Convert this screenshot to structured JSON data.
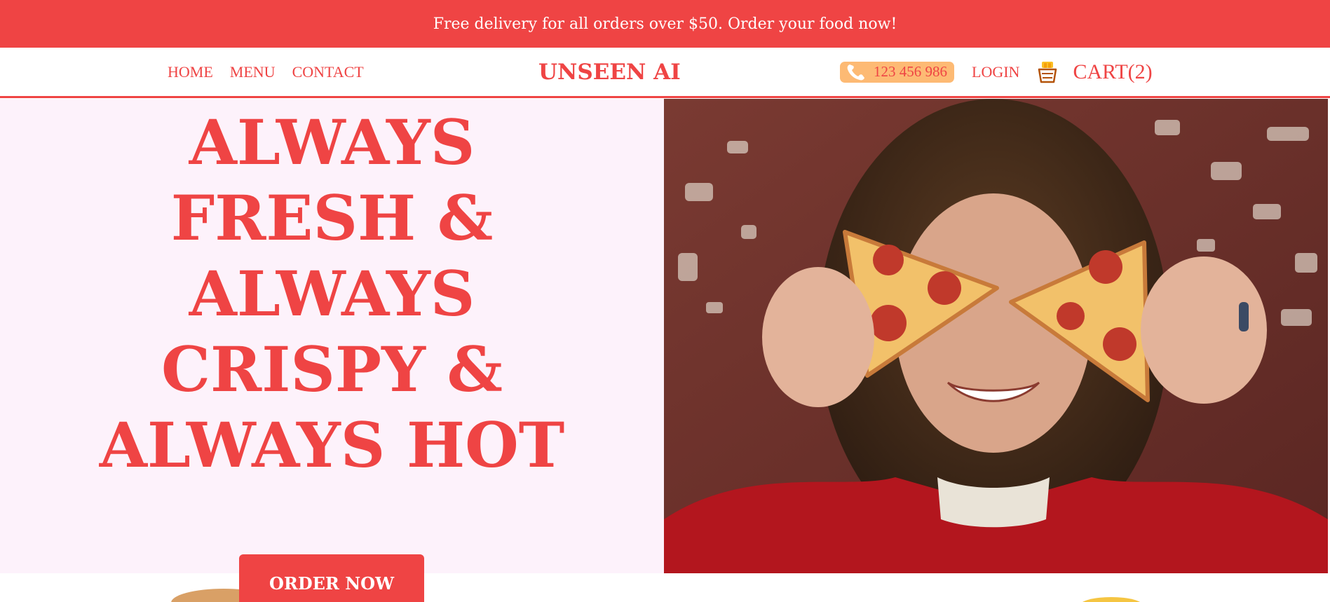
{
  "promo_banner": {
    "text": "Free delivery for all orders over $50. Order your food now!"
  },
  "nav": {
    "links": [
      {
        "label": "HOME"
      },
      {
        "label": "MENU"
      },
      {
        "label": "CONTACT"
      }
    ],
    "brand": "UNSEEN AI",
    "phone": {
      "icon": "phone-icon",
      "number": "123 456 986"
    },
    "login_label": "LOGIN",
    "basket_icon": "basket-icon",
    "cart_label": "CART(2)"
  },
  "hero": {
    "headline_lines": [
      "ALWAYS",
      "FRESH &",
      "ALWAYS",
      "CRISPY &",
      "ALWAYS HOT"
    ],
    "order_button_label": "ORDER NOW",
    "image_description_icon": "person-holding-pizza-slices-photo"
  },
  "colors": {
    "accent": "#ef4444",
    "hero_background": "#fdf2fb",
    "phone_pill": "#fdba74",
    "banner_text": "#ffffff"
  }
}
